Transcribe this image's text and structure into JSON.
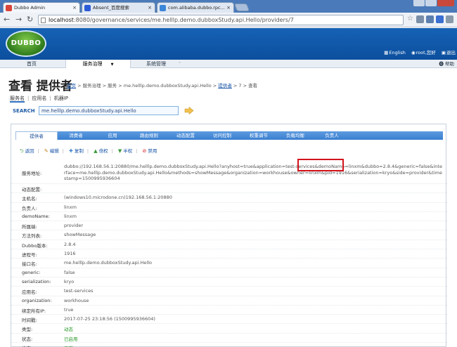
{
  "browser": {
    "tabs": [
      {
        "title": "Dubbo Admin",
        "active": true,
        "color": "#d9453a"
      },
      {
        "title": "Absent_百度搜索",
        "active": false,
        "color": "#2b5bd6"
      },
      {
        "title": "com.alibaba.dubbo.rpc...",
        "active": false,
        "color": "#3b86d8"
      }
    ],
    "close_glyph": "×",
    "url_host": "localhost",
    "url_path": ":8080/governance/services/me.helllp.demo.dubboxStudy.api.Hello/providers/7"
  },
  "header": {
    "logo_text": "DUBBO",
    "links": [
      "English",
      "root,您好",
      "退出"
    ]
  },
  "main_nav": {
    "items": [
      "首页",
      "服务治理",
      "系统管理"
    ],
    "active_caret": "▼",
    "system_caret": "˅",
    "help": "帮助"
  },
  "page": {
    "title": "查看 提供者",
    "breadcrumb": {
      "home": "首页",
      "path": " > 服务治理 > 服务 > me.helllp.demo.dubboxStudy.api.Hello > ",
      "providers": "提供者",
      "tail": " > 7 > 查看"
    },
    "subnav": [
      "服务名",
      "应用名",
      "机器IP"
    ],
    "search_label": "SEARCH",
    "search_value": "me.helllp.demo.dubboxStudy.api.Hello"
  },
  "tabs": [
    "提供者",
    "消费者",
    "应用",
    "路由规则",
    "动态配置",
    "访问控制",
    "权重调节",
    "负载均衡",
    "负责人"
  ],
  "actions": [
    {
      "icon": "⮌",
      "label": "返回"
    },
    {
      "icon": "✎",
      "label": "编辑"
    },
    {
      "icon": "✚",
      "label": "复制"
    },
    {
      "icon": "▲",
      "label": "倍权"
    },
    {
      "icon": "▼",
      "label": "半权"
    },
    {
      "icon": "⊘",
      "label": "禁用"
    }
  ],
  "details": [
    {
      "key": "服务地址:",
      "value": "dubbo://192.168.56.1:20880/me.helllp.demo.dubboxStudy.api.Hello?anyhost=true&application=test-services&demoName=linxm&dubbo=2.8.4&generic=false&interface=me.helllp.demo.dubboxStudy.api.Hello&methods=showMessage&organization=workhouse&owner=linxm&pid=1916&serialization=kryo&side=provider&timestamp=1500995936604"
    },
    {
      "key": "动态配置:",
      "value": ""
    },
    {
      "key": "主机名:",
      "value": "(windows10.microdone.cn)192.168.56.1:20880"
    },
    {
      "key": "负责人:",
      "value": "linxm"
    },
    {
      "key": "demoName:",
      "value": "linxm"
    },
    {
      "key": "所属端:",
      "value": "provider"
    },
    {
      "key": "方法列表:",
      "value": "showMessage"
    },
    {
      "key": "Dubbo版本:",
      "value": "2.8.4"
    },
    {
      "key": "进程号:",
      "value": "1916"
    },
    {
      "key": "接口名:",
      "value": "me.helllp.demo.dubboxStudy.api.Hello"
    },
    {
      "key": "generic:",
      "value": "false"
    },
    {
      "key": "serialization:",
      "value": "kryo"
    },
    {
      "key": "应用名:",
      "value": "test-services"
    },
    {
      "key": "organization:",
      "value": "workhouse"
    },
    {
      "key": "绑定所有IP:",
      "value": "true"
    },
    {
      "key": "时间戳:",
      "value": "2017-07-25 23:18:56 (1500995936604)"
    },
    {
      "key": "类型:",
      "value": "动态"
    },
    {
      "key": "状态:",
      "value": "已启用"
    },
    {
      "key": "检查:",
      "value": "正常"
    }
  ]
}
